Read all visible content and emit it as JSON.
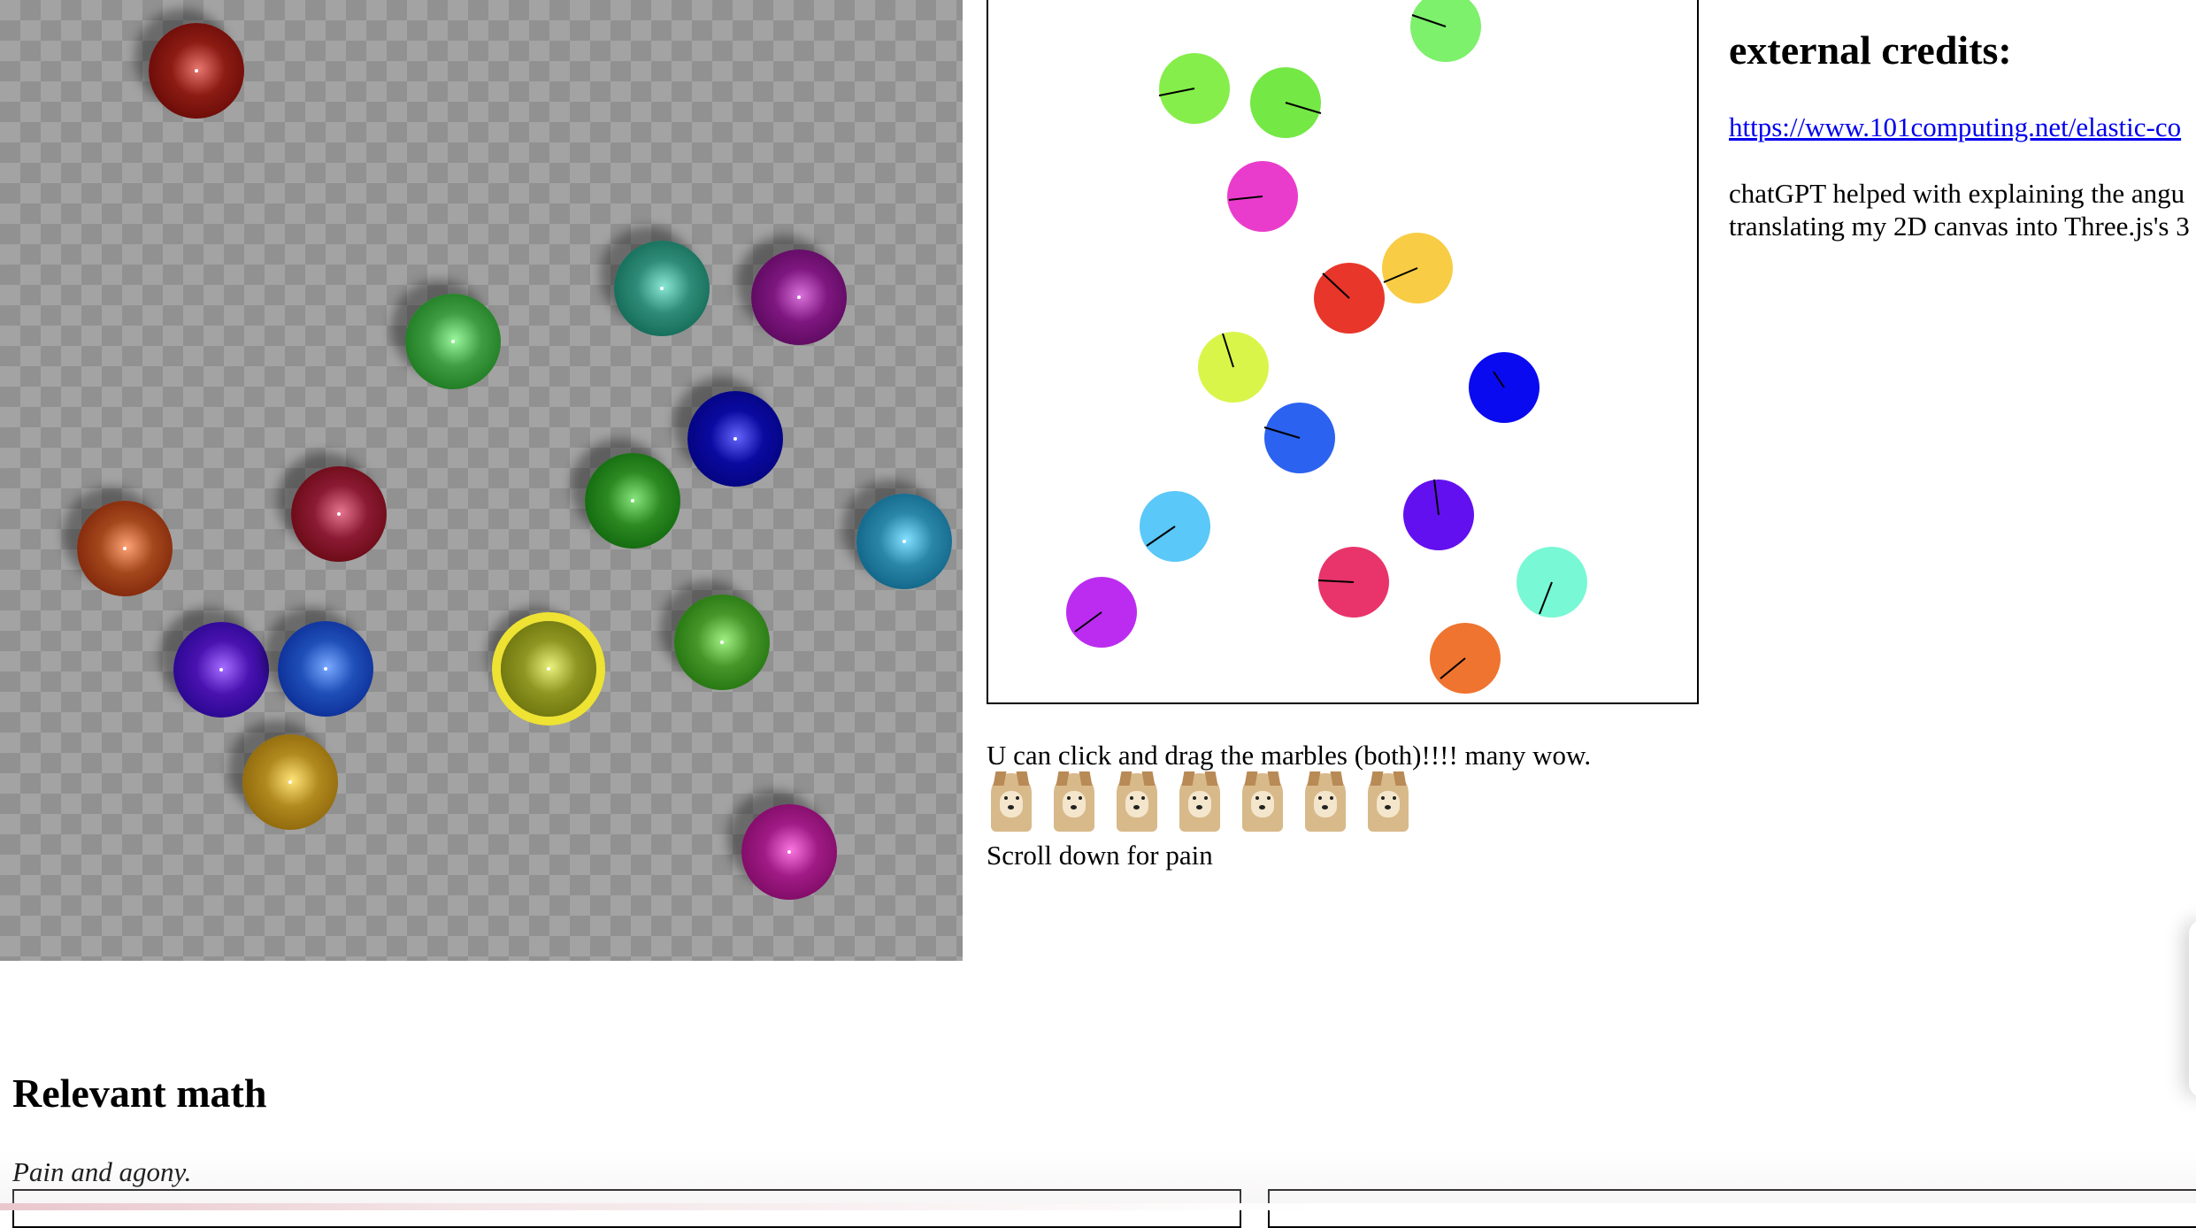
{
  "three_scene": {
    "marbles": [
      {
        "color": "#8c1c14",
        "highlighted": false
      },
      {
        "color": "#3f9c42",
        "highlighted": false
      },
      {
        "color": "#2f8c78",
        "highlighted": false
      },
      {
        "color": "#7e1780",
        "highlighted": false
      },
      {
        "color": "#0a0aa0",
        "highlighted": false
      },
      {
        "color": "#8b1a34",
        "highlighted": false
      },
      {
        "color": "#2d8a22",
        "highlighted": false
      },
      {
        "color": "#a3481c",
        "highlighted": false
      },
      {
        "color": "#2a86a8",
        "highlighted": false
      },
      {
        "color": "#4a12b0",
        "highlighted": false
      },
      {
        "color": "#1f4fb8",
        "highlighted": false
      },
      {
        "color": "#8f9622",
        "highlighted": true,
        "highlight_color": "#eee233"
      },
      {
        "color": "#46962a",
        "highlighted": false
      },
      {
        "color": "#b0891e",
        "highlighted": false
      },
      {
        "color": "#a01b86",
        "highlighted": false
      }
    ]
  },
  "flat_scene": {
    "marbles": [
      {
        "color": "#7df06c"
      },
      {
        "color": "#86ee4a"
      },
      {
        "color": "#74e844"
      },
      {
        "color": "#ea3ccc"
      },
      {
        "color": "#e8362a"
      },
      {
        "color": "#f8cc44"
      },
      {
        "color": "#d9f54a"
      },
      {
        "color": "#0a0af0"
      },
      {
        "color": "#2c62f0"
      },
      {
        "color": "#5ac8f8"
      },
      {
        "color": "#6210f0"
      },
      {
        "color": "#bb2cf0"
      },
      {
        "color": "#e8346a"
      },
      {
        "color": "#78f8d4"
      },
      {
        "color": "#ee7430"
      }
    ]
  },
  "captions": {
    "drag_hint": "U can click and drag the marbles (both)!!!! many wow.",
    "scroll_hint": "Scroll down for pain"
  },
  "doge_count": 7,
  "credits": {
    "title": "external credits:",
    "link_text": "https://www.101computing.net/elastic-co",
    "text": "chatGPT helped with explaining the angu translating my 2D canvas into Three.js's 3"
  },
  "math": {
    "title": "Relevant math",
    "subtitle": "Pain and agony."
  }
}
